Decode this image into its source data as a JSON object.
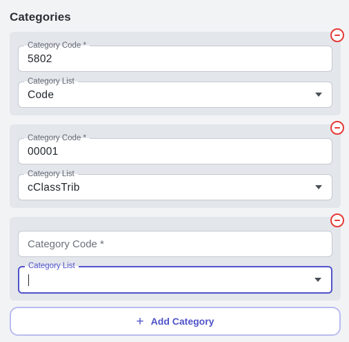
{
  "section": {
    "title": "Categories"
  },
  "categories": [
    {
      "code": {
        "label": "Category Code *",
        "value": "5802"
      },
      "list": {
        "label": "Category List",
        "value": "Code"
      }
    },
    {
      "code": {
        "label": "Category Code *",
        "value": "00001"
      },
      "list": {
        "label": "Category List",
        "value": "cClassTrib"
      }
    },
    {
      "code": {
        "placeholder": "Category Code *",
        "value": ""
      },
      "list": {
        "label": "Category List",
        "value": "",
        "focused": true
      }
    }
  ],
  "actions": {
    "add_label": "Add Category",
    "add_icon": "plus-icon",
    "remove_icon": "remove-circle-icon"
  },
  "colors": {
    "accent": "#4f52c9",
    "danger": "#e53935",
    "card_bg": "#e3e6eb"
  }
}
